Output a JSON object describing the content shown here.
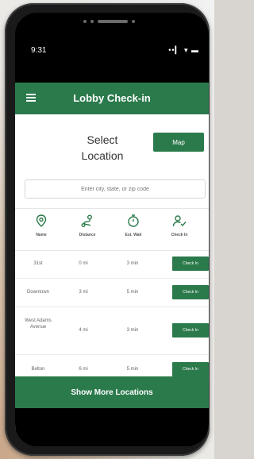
{
  "status": {
    "time": "9:31",
    "icons": "••▎ ▾ ▬"
  },
  "appbar": {
    "title": "Lobby Check-in"
  },
  "header": {
    "select_location_line1": "Select",
    "select_location_line2": "Location",
    "map_label": "Map"
  },
  "search": {
    "placeholder": "Enter city, state, or zip code"
  },
  "sort": [
    {
      "label": "Name",
      "icon": "map-pin-icon"
    },
    {
      "label": "Distance",
      "icon": "route-icon"
    },
    {
      "label": "Est. Wait",
      "icon": "stopwatch-icon"
    },
    {
      "label": "Check In",
      "icon": "user-check-icon"
    }
  ],
  "locations": [
    {
      "name": "31st",
      "distance": "0 mi",
      "wait": "3 min",
      "action": "Check In"
    },
    {
      "name": "Downtown",
      "distance": "3 mi",
      "wait": "5 min",
      "action": "Check In"
    },
    {
      "name": "West Adams Avenue",
      "distance": "4 mi",
      "wait": "3 min",
      "action": "Check In"
    },
    {
      "name": "Belton",
      "distance": "6 mi",
      "wait": "5 min",
      "action": "Check In"
    }
  ],
  "footer": {
    "show_more": "Show More Locations"
  },
  "colors": {
    "brand_green": "#2b7a4b"
  }
}
